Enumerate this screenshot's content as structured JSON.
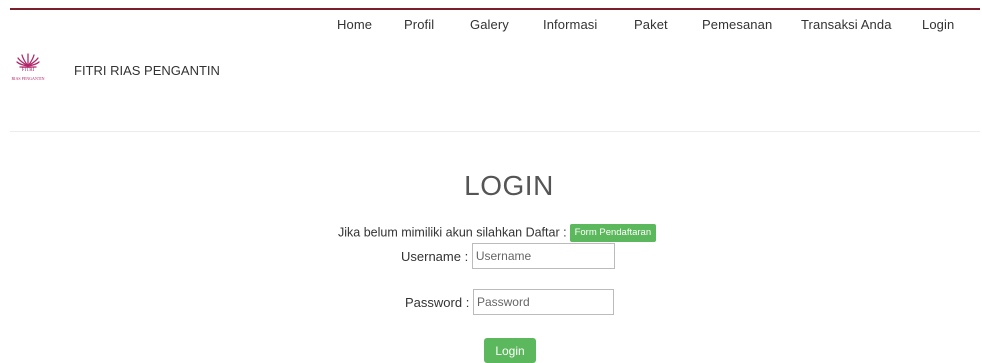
{
  "nav": {
    "items": [
      {
        "label": "Home"
      },
      {
        "label": "Profil"
      },
      {
        "label": "Galery"
      },
      {
        "label": "Informasi"
      },
      {
        "label": "Paket"
      },
      {
        "label": "Pemesanan"
      },
      {
        "label": "Transaksi Anda"
      },
      {
        "label": "Login"
      }
    ]
  },
  "brand": {
    "name": "FITRI RIAS PENGANTIN",
    "logo_text": "FITRI",
    "logo_subtext": "RIAS PENGANTIN"
  },
  "main": {
    "title": "LOGIN",
    "register_prompt": "Jika belum mimiliki akun silahkan Daftar :",
    "register_button": "Form Pendaftaran",
    "username_label": "Username :",
    "username_placeholder": "Username",
    "password_label": "Password :",
    "password_placeholder": "Password",
    "login_button": "Login"
  },
  "colors": {
    "accent_rule": "#7a1f2b",
    "button_green": "#5cb85c",
    "logo_pink": "#b0286a"
  },
  "icons": {
    "logo": "lotus-flower-icon"
  }
}
